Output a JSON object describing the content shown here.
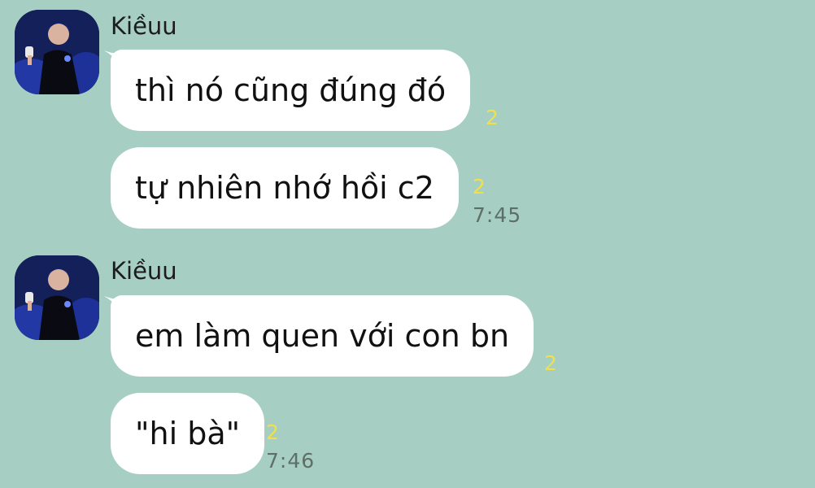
{
  "chat": {
    "groups": [
      {
        "sender": "Kiềuu",
        "messages": [
          {
            "text": "thì nó cũng đúng đó",
            "unread": "2",
            "time": ""
          },
          {
            "text": "tự nhiên nhớ hồi c2",
            "unread": "2",
            "time": "7:45"
          }
        ]
      },
      {
        "sender": "Kiềuu",
        "messages": [
          {
            "text": "em làm quen với con bn",
            "unread": "2",
            "time": ""
          },
          {
            "text": "\"hi bà\"",
            "unread": "2",
            "time": "7:46"
          }
        ]
      }
    ]
  },
  "colors": {
    "background": "#a6cec2",
    "bubble": "#ffffff",
    "unread": "#f1e04a",
    "time": "#5d6f67"
  },
  "icons": [
    "avatar-photo"
  ]
}
